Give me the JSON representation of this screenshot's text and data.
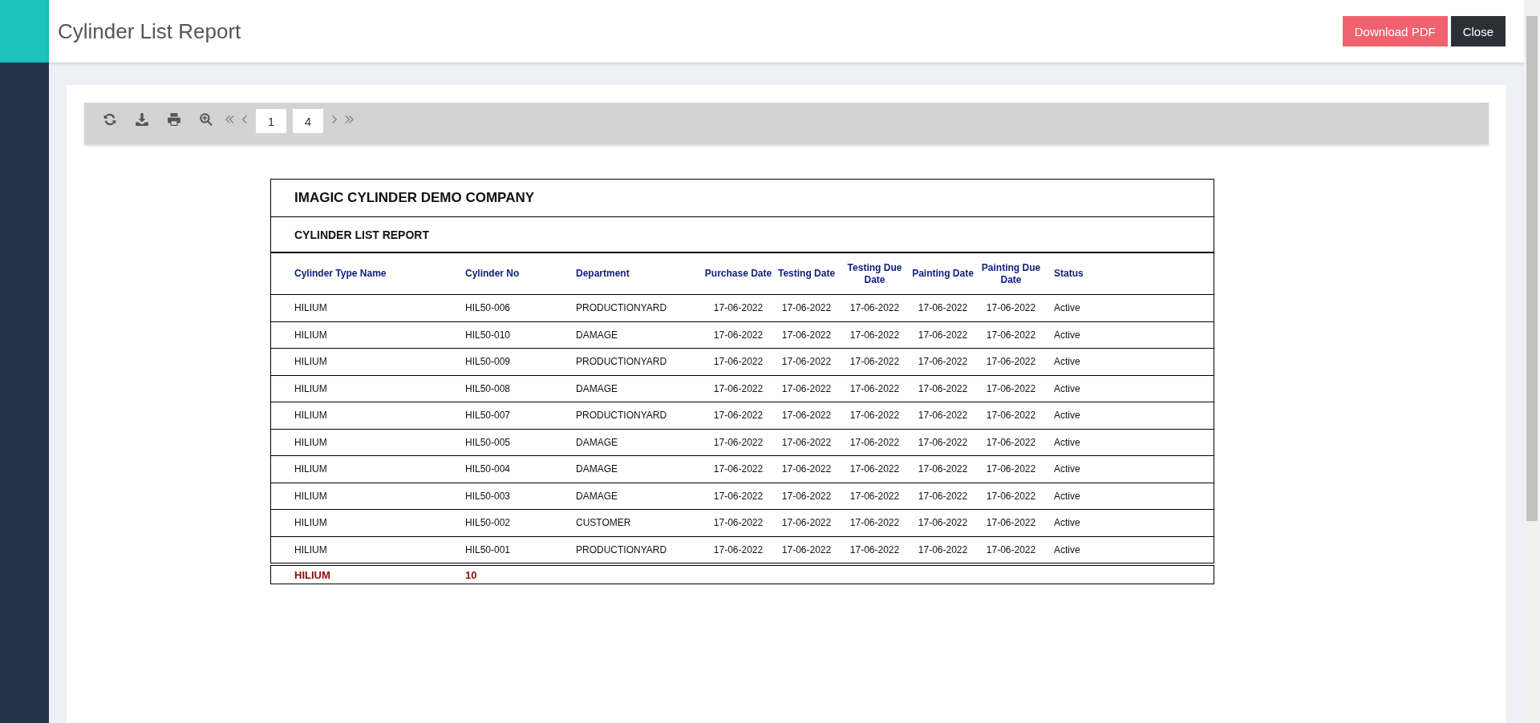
{
  "header": {
    "title": "Cylinder List Report",
    "buttons": [
      {
        "label": "Download PDF",
        "kind": "primary"
      },
      {
        "label": "Close",
        "kind": "dark"
      }
    ]
  },
  "toolbar": {
    "page": "1",
    "total_pages": "4"
  },
  "report": {
    "company": "IMAGIC CYLINDER DEMO COMPANY",
    "title": "CYLINDER LIST REPORT",
    "columns": [
      "Cylinder Type Name",
      "Cylinder No",
      "Department",
      "Purchase Date",
      "Testing Date",
      "Testing Due Date",
      "Painting Date",
      "Painting Due Date",
      "Status"
    ],
    "rows": [
      [
        "HILIUM",
        "HIL50-006",
        "PRODUCTIONYARD",
        "17-06-2022",
        "17-06-2022",
        "17-06-2022",
        "17-06-2022",
        "17-06-2022",
        "Active"
      ],
      [
        "HILIUM",
        "HIL50-010",
        "DAMAGE",
        "17-06-2022",
        "17-06-2022",
        "17-06-2022",
        "17-06-2022",
        "17-06-2022",
        "Active"
      ],
      [
        "HILIUM",
        "HIL50-009",
        "PRODUCTIONYARD",
        "17-06-2022",
        "17-06-2022",
        "17-06-2022",
        "17-06-2022",
        "17-06-2022",
        "Active"
      ],
      [
        "HILIUM",
        "HIL50-008",
        "DAMAGE",
        "17-06-2022",
        "17-06-2022",
        "17-06-2022",
        "17-06-2022",
        "17-06-2022",
        "Active"
      ],
      [
        "HILIUM",
        "HIL50-007",
        "PRODUCTIONYARD",
        "17-06-2022",
        "17-06-2022",
        "17-06-2022",
        "17-06-2022",
        "17-06-2022",
        "Active"
      ],
      [
        "HILIUM",
        "HIL50-005",
        "DAMAGE",
        "17-06-2022",
        "17-06-2022",
        "17-06-2022",
        "17-06-2022",
        "17-06-2022",
        "Active"
      ],
      [
        "HILIUM",
        "HIL50-004",
        "DAMAGE",
        "17-06-2022",
        "17-06-2022",
        "17-06-2022",
        "17-06-2022",
        "17-06-2022",
        "Active"
      ],
      [
        "HILIUM",
        "HIL50-003",
        "DAMAGE",
        "17-06-2022",
        "17-06-2022",
        "17-06-2022",
        "17-06-2022",
        "17-06-2022",
        "Active"
      ],
      [
        "HILIUM",
        "HIL50-002",
        "CUSTOMER",
        "17-06-2022",
        "17-06-2022",
        "17-06-2022",
        "17-06-2022",
        "17-06-2022",
        "Active"
      ],
      [
        "HILIUM",
        "HIL50-001",
        "PRODUCTIONYARD",
        "17-06-2022",
        "17-06-2022",
        "17-06-2022",
        "17-06-2022",
        "17-06-2022",
        "Active"
      ]
    ],
    "summary": {
      "type_name": "HILIUM",
      "count": "10"
    }
  }
}
